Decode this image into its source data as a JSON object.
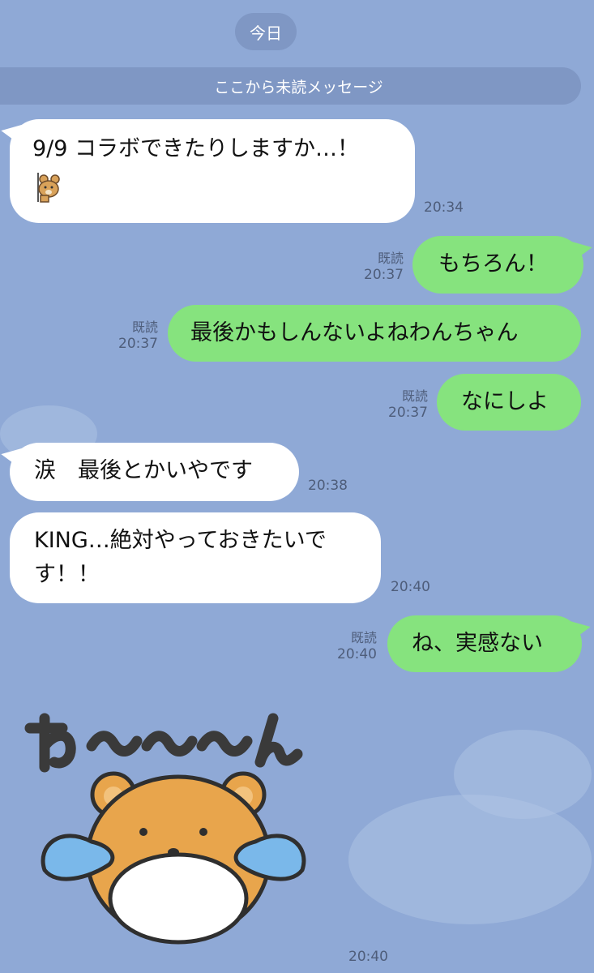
{
  "date_label": "今日",
  "unread_label": "ここから未読メッセージ",
  "read_label": "既読",
  "messages": [
    {
      "id": "m1",
      "direction": "incoming",
      "text_line1": "9/9 コラボできたりしますか…！",
      "time": "20:34",
      "has_emoji": true
    },
    {
      "id": "m2",
      "direction": "outgoing",
      "text": "もちろん！",
      "time": "20:37",
      "read": true
    },
    {
      "id": "m3",
      "direction": "outgoing",
      "text": "最後かもしんないよねわんちゃん",
      "time": "20:37",
      "read": true
    },
    {
      "id": "m4",
      "direction": "outgoing",
      "text": "なにしよ",
      "time": "20:37",
      "read": true
    },
    {
      "id": "m5",
      "direction": "incoming",
      "text": "涙　最後とかいやです",
      "time": "20:38"
    },
    {
      "id": "m6",
      "direction": "incoming",
      "text_line1": "KING…絶対やっておきたいで",
      "text_line2": "す！！",
      "time": "20:40"
    },
    {
      "id": "m7",
      "direction": "outgoing",
      "text": "ね、実感ない",
      "time": "20:40",
      "read": true
    },
    {
      "id": "m8",
      "direction": "incoming",
      "sticker": "crying-bear-sticker",
      "time": "20:40"
    }
  ],
  "colors": {
    "background": "#8fa9d6",
    "incoming_bubble": "#ffffff",
    "outgoing_bubble": "#86e37e",
    "pill": "#7f97c4"
  }
}
